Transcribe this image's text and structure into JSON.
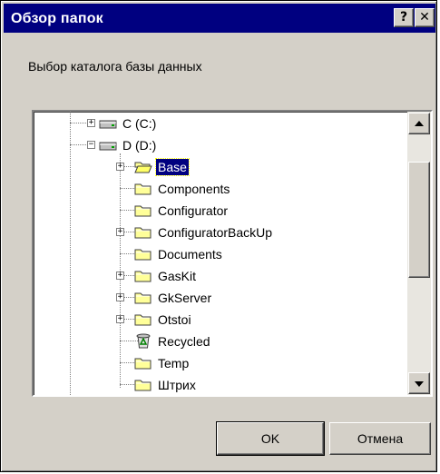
{
  "window": {
    "title": "Обзор папок",
    "help_glyph": "?",
    "close_glyph": "✕"
  },
  "prompt": "Выбор каталога базы данных",
  "tree": {
    "items": [
      {
        "label": "C (C:)",
        "icon": "drive-icon",
        "expander": "+",
        "selected": false
      },
      {
        "label": "D (D:)",
        "icon": "drive-icon",
        "expander": "−",
        "selected": false
      },
      {
        "label": "Base",
        "icon": "folder-open-icon",
        "expander": "+",
        "selected": true
      },
      {
        "label": "Components",
        "icon": "folder-icon",
        "expander": "",
        "selected": false
      },
      {
        "label": "Configurator",
        "icon": "folder-icon",
        "expander": "",
        "selected": false
      },
      {
        "label": "ConfiguratorBackUp",
        "icon": "folder-icon",
        "expander": "+",
        "selected": false
      },
      {
        "label": "Documents",
        "icon": "folder-icon",
        "expander": "",
        "selected": false
      },
      {
        "label": "GasKit",
        "icon": "folder-icon",
        "expander": "+",
        "selected": false
      },
      {
        "label": "GkServer",
        "icon": "folder-icon",
        "expander": "+",
        "selected": false
      },
      {
        "label": "Otstoi",
        "icon": "folder-icon",
        "expander": "+",
        "selected": false
      },
      {
        "label": "Recycled",
        "icon": "recycle-bin-icon",
        "expander": "",
        "selected": false
      },
      {
        "label": "Temp",
        "icon": "folder-icon",
        "expander": "",
        "selected": false
      },
      {
        "label": "Штрих",
        "icon": "folder-icon",
        "expander": "",
        "selected": false
      }
    ]
  },
  "buttons": {
    "ok": "OK",
    "cancel": "Отмена"
  },
  "colors": {
    "titlebar": "#000080",
    "face": "#d4d0c8",
    "selection": "#000080",
    "folder": "#ffff99"
  }
}
